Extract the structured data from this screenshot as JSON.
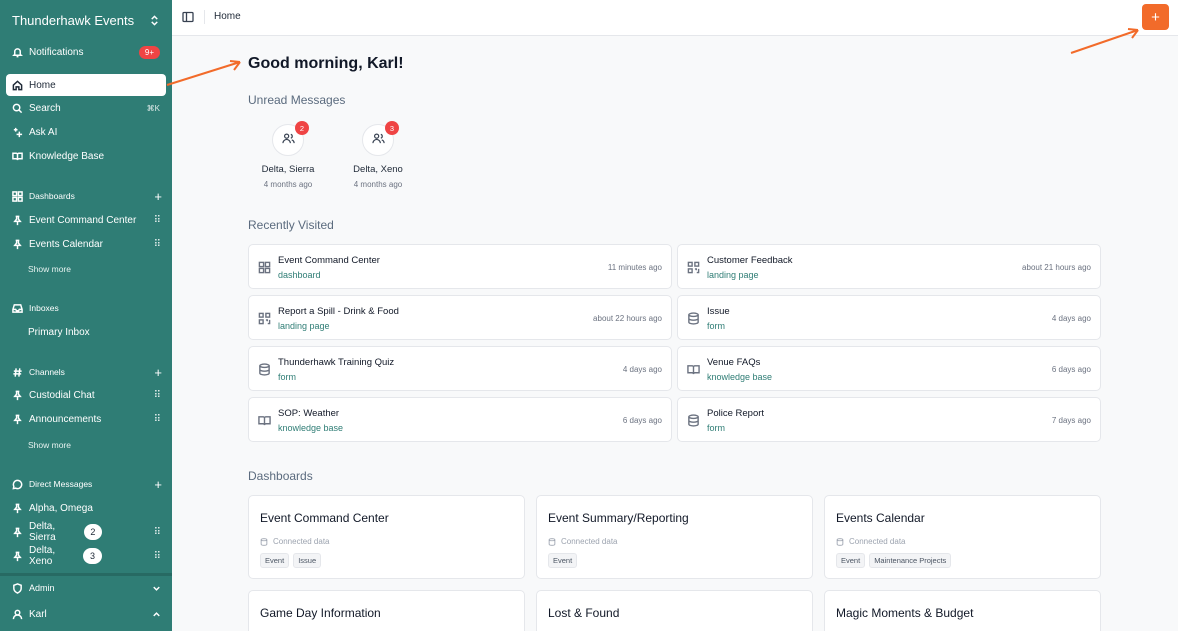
{
  "sidebar": {
    "workspace": "Thunderhawk Events",
    "notifications": {
      "label": "Notifications",
      "badge": "9+"
    },
    "home": "Home",
    "search": {
      "label": "Search",
      "shortcut": "⌘K"
    },
    "ask_ai": "Ask AI",
    "knowledge_base": "Knowledge Base",
    "dashboards": {
      "title": "Dashboards",
      "items": [
        "Event Command Center",
        "Events Calendar"
      ],
      "show_more": "Show more"
    },
    "inboxes": {
      "title": "Inboxes",
      "items": [
        "Primary Inbox"
      ]
    },
    "channels": {
      "title": "Channels",
      "items": [
        "Custodial Chat",
        "Announcements"
      ],
      "show_more": "Show more"
    },
    "direct_messages": {
      "title": "Direct Messages",
      "items": [
        {
          "label": "Alpha, Omega"
        },
        {
          "label": "Delta, Sierra",
          "count": "2"
        },
        {
          "label": "Delta, Xeno",
          "count": "3"
        }
      ]
    },
    "admin": "Admin",
    "user": "Karl"
  },
  "topbar": {
    "breadcrumb": "Home",
    "add_label": "+"
  },
  "main": {
    "greeting": "Good morning, Karl!",
    "unread": {
      "title": "Unread Messages",
      "items": [
        {
          "name": "Delta, Sierra",
          "time": "4 months ago",
          "badge": "2"
        },
        {
          "name": "Delta, Xeno",
          "time": "4 months ago",
          "badge": "3"
        }
      ]
    },
    "recent": {
      "title": "Recently Visited",
      "items": [
        {
          "title": "Event Command Center",
          "type": "dashboard",
          "ago": "11 minutes ago",
          "icon": "dashboard-icon"
        },
        {
          "title": "Customer Feedback",
          "type": "landing page",
          "ago": "about 21 hours ago",
          "icon": "qr-icon"
        },
        {
          "title": "Report a Spill - Drink & Food",
          "type": "landing page",
          "ago": "about 22 hours ago",
          "icon": "qr-icon"
        },
        {
          "title": "Issue",
          "type": "form",
          "ago": "4 days ago",
          "icon": "database-icon"
        },
        {
          "title": "Thunderhawk Training Quiz",
          "type": "form",
          "ago": "4 days ago",
          "icon": "database-icon"
        },
        {
          "title": "Venue FAQs",
          "type": "knowledge base",
          "ago": "6 days ago",
          "icon": "book-icon"
        },
        {
          "title": "SOP: Weather",
          "type": "knowledge base",
          "ago": "6 days ago",
          "icon": "book-icon"
        },
        {
          "title": "Police Report",
          "type": "form",
          "ago": "7 days ago",
          "icon": "database-icon"
        }
      ]
    },
    "dashboards": {
      "title": "Dashboards",
      "connected_label": "Connected data",
      "items": [
        {
          "title": "Event Command Center",
          "tags": [
            "Event",
            "Issue"
          ]
        },
        {
          "title": "Event Summary/Reporting",
          "tags": [
            "Event"
          ]
        },
        {
          "title": "Events Calendar",
          "tags": [
            "Event",
            "Maintenance Projects"
          ]
        },
        {
          "title": "Game Day Information",
          "tags": []
        },
        {
          "title": "Lost & Found",
          "tags": []
        },
        {
          "title": "Magic Moments & Budget",
          "tags": []
        }
      ]
    }
  },
  "colors": {
    "sidebar": "#2f7d75",
    "accent": "#f26b2a",
    "badge": "#ef4444",
    "link": "#2f7d75"
  }
}
